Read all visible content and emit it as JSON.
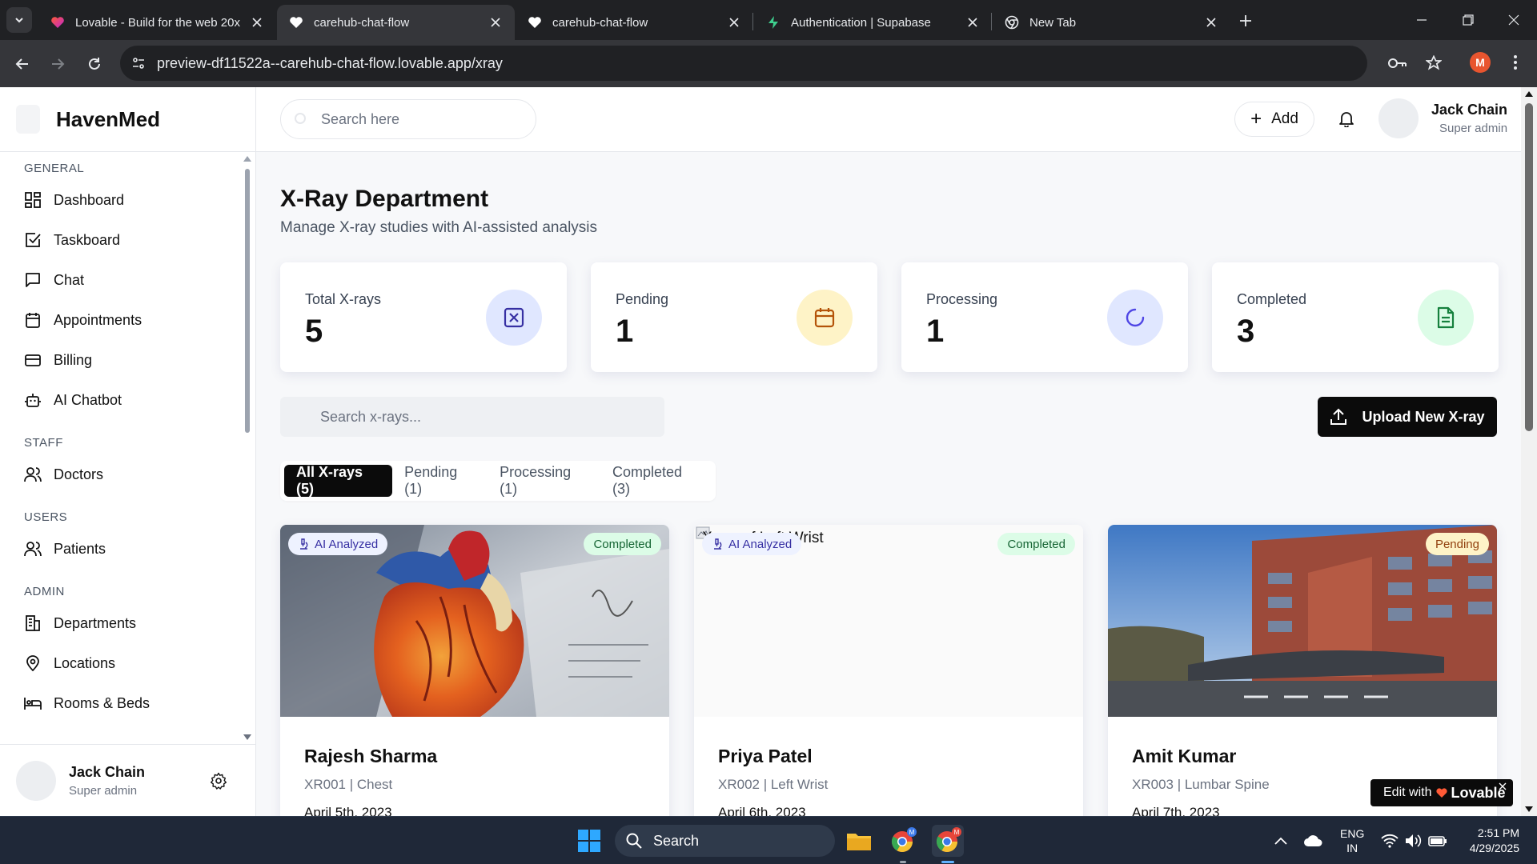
{
  "browser": {
    "tabs": [
      {
        "title": "Lovable - Build for the web 20x",
        "icon": "lovable-heart-icon"
      },
      {
        "title": "carehub-chat-flow",
        "icon": "heart-icon",
        "active": true
      },
      {
        "title": "carehub-chat-flow",
        "icon": "heart-icon"
      },
      {
        "title": "Authentication | Supabase",
        "icon": "supabase-bolt-icon"
      },
      {
        "title": "New Tab",
        "icon": "chrome-icon"
      }
    ],
    "url": "preview-df11522a--carehub-chat-flow.lovable.app/xray",
    "profile_initial": "M"
  },
  "app": {
    "brand": "HavenMed",
    "header": {
      "search_placeholder": "Search here",
      "add_label": "Add",
      "user_name": "Jack Chain",
      "user_role": "Super admin"
    },
    "sidebar": {
      "sections": [
        {
          "title": "GENERAL",
          "items": [
            {
              "label": "Dashboard",
              "icon": "dashboard-icon"
            },
            {
              "label": "Taskboard",
              "icon": "checkbox-icon"
            },
            {
              "label": "Chat",
              "icon": "chat-icon"
            },
            {
              "label": "Appointments",
              "icon": "calendar-icon"
            },
            {
              "label": "Billing",
              "icon": "card-icon"
            },
            {
              "label": "AI Chatbot",
              "icon": "bot-icon"
            }
          ]
        },
        {
          "title": "STAFF",
          "items": [
            {
              "label": "Doctors",
              "icon": "users-icon"
            }
          ]
        },
        {
          "title": "USERS",
          "items": [
            {
              "label": "Patients",
              "icon": "users-icon"
            }
          ]
        },
        {
          "title": "ADMIN",
          "items": [
            {
              "label": "Departments",
              "icon": "building-icon"
            },
            {
              "label": "Locations",
              "icon": "pin-icon"
            },
            {
              "label": "Rooms & Beds",
              "icon": "bed-icon"
            }
          ]
        }
      ],
      "user_name": "Jack Chain",
      "user_role": "Super admin"
    }
  },
  "page": {
    "title": "X-Ray Department",
    "subtitle": "Manage X-ray studies with AI-assisted analysis",
    "stats": [
      {
        "label": "Total X-rays",
        "value": "5",
        "icon": "xray-icon",
        "color": "#e0e7ff",
        "icon_color": "#3730a3"
      },
      {
        "label": "Pending",
        "value": "1",
        "icon": "calendar-icon",
        "color": "#fef3c7",
        "icon_color": "#b45309"
      },
      {
        "label": "Processing",
        "value": "1",
        "icon": "spinner-icon",
        "color": "#e0e7ff",
        "icon_color": "#4f46e5"
      },
      {
        "label": "Completed",
        "value": "3",
        "icon": "document-icon",
        "color": "#dcfce7",
        "icon_color": "#15803d"
      }
    ],
    "xray_search_placeholder": "Search x-rays...",
    "upload_label": "Upload New X-ray",
    "filter_tabs": [
      "All X-rays (5)",
      "Pending (1)",
      "Processing (1)",
      "Completed (3)"
    ],
    "cards": [
      {
        "name": "Rajesh Sharma",
        "id_line": "XR001 | Chest",
        "date": "April 5th, 2023",
        "status": "Completed",
        "ai_badge": "AI Analyzed",
        "image": "heart-model-photo"
      },
      {
        "name": "Priya Patel",
        "id_line": "XR002 | Left Wrist",
        "date": "April 6th, 2023",
        "status": "Completed",
        "ai_badge": "AI Analyzed",
        "image_alt": "X-ray of Left Wrist"
      },
      {
        "name": "Amit Kumar",
        "id_line": "XR003 | Lumbar Spine",
        "date": "April 7th, 2023",
        "status": "Pending",
        "image": "hospital-building-photo"
      }
    ],
    "lovable_badge": {
      "prefix": "Edit with",
      "brand": "Lovable"
    }
  },
  "taskbar": {
    "search_label": "Search",
    "lang_top": "ENG",
    "lang_bottom": "IN",
    "time": "2:51 PM",
    "date": "4/29/2025"
  }
}
